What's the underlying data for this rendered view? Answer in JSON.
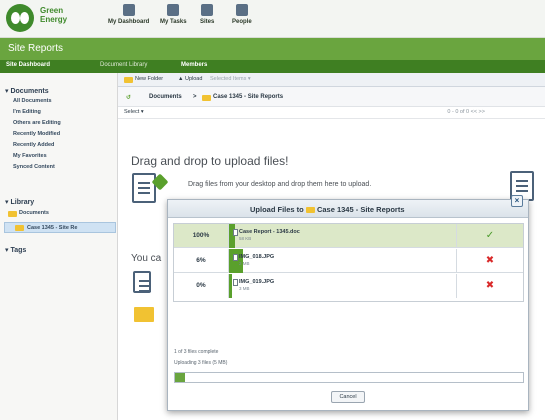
{
  "header": {
    "brand_line1": "Green",
    "brand_line2": "Energy",
    "nav": [
      "My Dashboard",
      "My Tasks",
      "Sites",
      "People"
    ]
  },
  "site": {
    "title": "Site Reports",
    "subnav": [
      "Site Dashboard",
      "Document Library",
      "Members"
    ]
  },
  "sidebar": {
    "documents_heading": "Documents",
    "documents_items": [
      "All Documents",
      "I'm Editing",
      "Others are Editing",
      "Recently Modified",
      "Recently Added",
      "My Favorites",
      "Synced Content"
    ],
    "library_heading": "Library",
    "library_items": [
      "Documents",
      "Case 1345 - Site Re"
    ],
    "tags_heading": "Tags"
  },
  "toolbar": {
    "new_folder": "New Folder",
    "upload": "Upload",
    "selected_items": "Selected Items"
  },
  "breadcrumb": {
    "root": "Documents",
    "sep": ">",
    "current": "Case 1345 - Site Reports"
  },
  "list": {
    "select": "Select ▾",
    "pager": "0 - 0 of 0   <<   >>"
  },
  "dropzone": {
    "title": "Drag and drop to upload files!",
    "subtitle": "Drag files from your desktop and drop them here to upload.",
    "you_can": "You ca"
  },
  "upload_dialog": {
    "title_prefix": "Upload Files to",
    "title_folder": "Case 1345 - Site Reports",
    "close_label": "×",
    "files": [
      {
        "percent": "100%",
        "progress": 1.0,
        "name": "Case Report - 1345.doc",
        "size": "58 KB",
        "status": "ok",
        "status_glyph": "✓"
      },
      {
        "percent": "6%",
        "progress": 0.06,
        "name": "IMG_018.JPG",
        "size": "2 MB",
        "status": "error",
        "status_glyph": "✖"
      },
      {
        "percent": "0%",
        "progress": 0.0,
        "name": "IMG_019.JPG",
        "size": "3 MB",
        "status": "error",
        "status_glyph": "✖"
      }
    ],
    "complete_text": "1 of 3 files complete",
    "uploading_text": "Uploading 3 files (5 MB)",
    "overall_progress": 0.03,
    "cancel_label": "Cancel"
  },
  "colors": {
    "brand_green": "#3f8a2c",
    "site_bar": "#6aa53f",
    "subnav_bar": "#3f7f22",
    "ok": "#4a9a2a",
    "error": "#d92a2a"
  }
}
